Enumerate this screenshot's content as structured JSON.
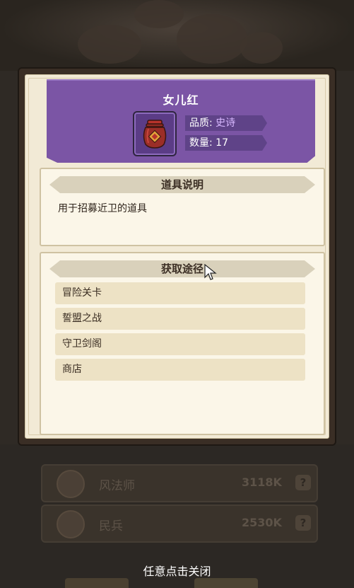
{
  "item": {
    "name": "女儿红",
    "quality_label": "品质: ",
    "quality_value": "史诗",
    "count_label": "数量: ",
    "count_value": "17",
    "quality_color": "#d8b8ff"
  },
  "description": {
    "heading": "道具说明",
    "text": "用于招募近卫的道具"
  },
  "sources": {
    "heading": "获取途径",
    "items": [
      "冒险关卡",
      "誓盟之战",
      "守卫剑阁",
      "商店"
    ]
  },
  "background": {
    "rows": [
      {
        "name": "风法师",
        "power": "3118K",
        "icon": "question-icon"
      },
      {
        "name": "民兵",
        "power": "2530K",
        "icon": "question-icon"
      }
    ]
  },
  "footer": {
    "close_hint": "任意点击关闭"
  },
  "colors": {
    "header_purple": "#7b55a5",
    "panel_bg": "#fbf6e8",
    "frame_brown": "#3a2e25"
  }
}
